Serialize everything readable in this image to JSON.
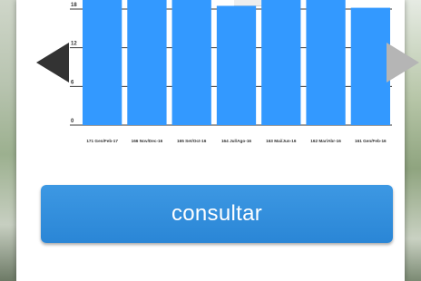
{
  "chart_data": {
    "type": "bar",
    "categories": [
      "171 Gen/Feb-17",
      "166 Nov/Dec-16",
      "165 Set/Oct-16",
      "164 Jul/Ago-16",
      "163 Mai/Jun-16",
      "162 Mar/Abr-16",
      "161 Gen/Feb-16"
    ],
    "values": [
      21,
      21,
      21,
      18.5,
      19.5,
      19.5,
      18.2
    ],
    "yticks": [
      "0",
      "6",
      "12",
      "18"
    ],
    "ylim": [
      0,
      21
    ],
    "grid": true,
    "bar_color": "#3399ff",
    "title": "",
    "xlabel": "",
    "ylabel": ""
  },
  "nav": {
    "prev_icon": "arrow-left-icon",
    "next_icon": "arrow-right-icon",
    "prev_color": "#333333",
    "next_color": "#b5b5b5"
  },
  "action": {
    "consult_label": "consultar",
    "button_color": "#2f8fdf"
  }
}
